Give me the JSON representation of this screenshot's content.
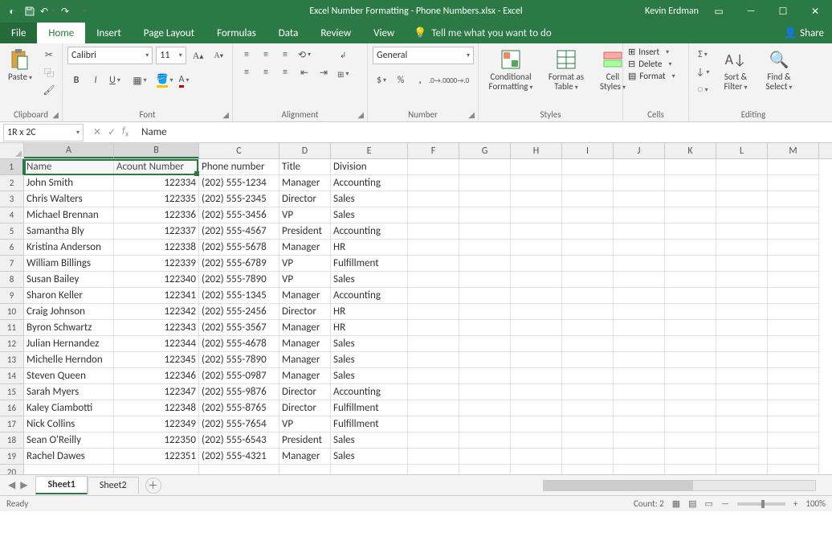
{
  "title": "Excel Number Formatting - Phone Numbers.xlsx - Excel",
  "user": "Kevin Erdman",
  "tabs": {
    "file": "File",
    "home": "Home",
    "insert": "Insert",
    "pageLayout": "Page Layout",
    "formulas": "Formulas",
    "data": "Data",
    "review": "Review",
    "view": "View",
    "tellme": "Tell me what you want to do",
    "share": "Share"
  },
  "ribbon": {
    "clipboard": {
      "paste": "Paste",
      "label": "Clipboard"
    },
    "font": {
      "name": "Calibri",
      "size": "11",
      "label": "Font"
    },
    "alignment": {
      "label": "Alignment",
      "wrap": "Wrap Text",
      "merge": "Merge & Center"
    },
    "number": {
      "format": "General",
      "label": "Number"
    },
    "styles": {
      "cond": "Conditional Formatting",
      "table": "Format as Table",
      "cell": "Cell Styles",
      "label": "Styles"
    },
    "cells": {
      "insert": "Insert",
      "delete": "Delete",
      "format": "Format",
      "label": "Cells"
    },
    "editing": {
      "sort": "Sort & Filter",
      "find": "Find & Select",
      "label": "Editing"
    }
  },
  "nameBox": "1R x 2C",
  "formula": "Name",
  "columns": [
    "A",
    "B",
    "C",
    "D",
    "E",
    "F",
    "G",
    "H",
    "I",
    "J",
    "K",
    "L",
    "M"
  ],
  "headers": {
    "a": "Name",
    "b": "Acount Number",
    "c": "Phone number",
    "d": "Title",
    "e": "Division"
  },
  "rows": [
    {
      "n": "1"
    },
    {
      "n": "2",
      "a": "John Smith",
      "b": "122334",
      "c": "(202) 555-1234",
      "d": "Manager",
      "e": "Accounting"
    },
    {
      "n": "3",
      "a": "Chris Walters",
      "b": "122335",
      "c": "(202) 555-2345",
      "d": "Director",
      "e": "Sales"
    },
    {
      "n": "4",
      "a": "Michael Brennan",
      "b": "122336",
      "c": "(202) 555-3456",
      "d": "VP",
      "e": "Sales"
    },
    {
      "n": "5",
      "a": "Samantha Bly",
      "b": "122337",
      "c": "(202) 555-4567",
      "d": "President",
      "e": "Accounting"
    },
    {
      "n": "6",
      "a": "Kristina Anderson",
      "b": "122338",
      "c": "(202) 555-5678",
      "d": "Manager",
      "e": "HR"
    },
    {
      "n": "7",
      "a": "William Billings",
      "b": "122339",
      "c": "(202) 555-6789",
      "d": "VP",
      "e": "Fulfillment"
    },
    {
      "n": "8",
      "a": "Susan Bailey",
      "b": "122340",
      "c": "(202) 555-7890",
      "d": "VP",
      "e": "Sales"
    },
    {
      "n": "9",
      "a": "Sharon Keller",
      "b": "122341",
      "c": "(202) 555-1345",
      "d": "Manager",
      "e": "Accounting"
    },
    {
      "n": "10",
      "a": "Craig Johnson",
      "b": "122342",
      "c": "(202) 555-2456",
      "d": "Director",
      "e": "HR"
    },
    {
      "n": "11",
      "a": "Byron Schwartz",
      "b": "122343",
      "c": "(202) 555-3567",
      "d": "Manager",
      "e": "HR"
    },
    {
      "n": "12",
      "a": "Julian Hernandez",
      "b": "122344",
      "c": "(202) 555-4678",
      "d": "Manager",
      "e": "Sales"
    },
    {
      "n": "13",
      "a": "Michelle Herndon",
      "b": "122345",
      "c": "(202) 555-7890",
      "d": "Manager",
      "e": "Sales"
    },
    {
      "n": "14",
      "a": "Steven Queen",
      "b": "122346",
      "c": "(202) 555-0987",
      "d": "Manager",
      "e": "Sales"
    },
    {
      "n": "15",
      "a": "Sarah Myers",
      "b": "122347",
      "c": "(202) 555-9876",
      "d": "Director",
      "e": "Accounting"
    },
    {
      "n": "16",
      "a": "Kaley Ciambotti",
      "b": "122348",
      "c": "(202) 555-8765",
      "d": "Director",
      "e": "Fulfillment"
    },
    {
      "n": "17",
      "a": "Nick Collins",
      "b": "122349",
      "c": "(202) 555-7654",
      "d": "VP",
      "e": "Fulfillment"
    },
    {
      "n": "18",
      "a": "Sean O'Reilly",
      "b": "122350",
      "c": "(202) 555-6543",
      "d": "President",
      "e": "Sales"
    },
    {
      "n": "19",
      "a": "Rachel Dawes",
      "b": "122351",
      "c": "(202) 555-4321",
      "d": "Manager",
      "e": "Sales"
    },
    {
      "n": "20"
    }
  ],
  "sheets": {
    "s1": "Sheet1",
    "s2": "Sheet2"
  },
  "status": {
    "ready": "Ready",
    "count": "Count: 2",
    "zoom": "100%"
  }
}
